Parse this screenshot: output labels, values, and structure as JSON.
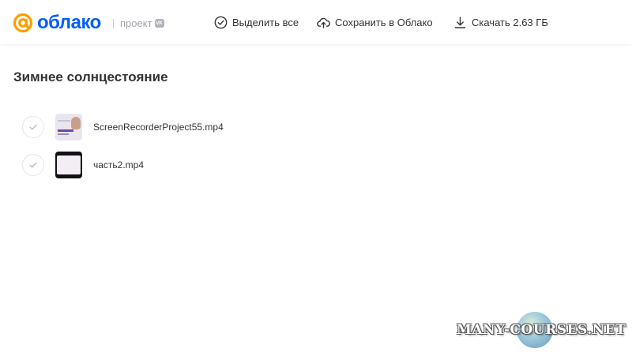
{
  "header": {
    "logo_text": "облако",
    "project_label": "проект",
    "vk_badge": "VK",
    "actions": {
      "select_all": "Выделить все",
      "save_to_cloud": "Сохранить в Облако",
      "download": "Скачать 2.63 ГБ"
    }
  },
  "folder": {
    "title": "Зимнее солнцестояние",
    "files": [
      {
        "name": "ScreenRecorderProject55.mp4"
      },
      {
        "name": "часть2.mp4"
      }
    ]
  },
  "watermark": {
    "text": "MANY-COURSES.NET"
  },
  "colors": {
    "brand_orange": "#ff9e00",
    "brand_blue": "#005ff9",
    "text": "#333333",
    "muted": "#a0a4aa"
  }
}
